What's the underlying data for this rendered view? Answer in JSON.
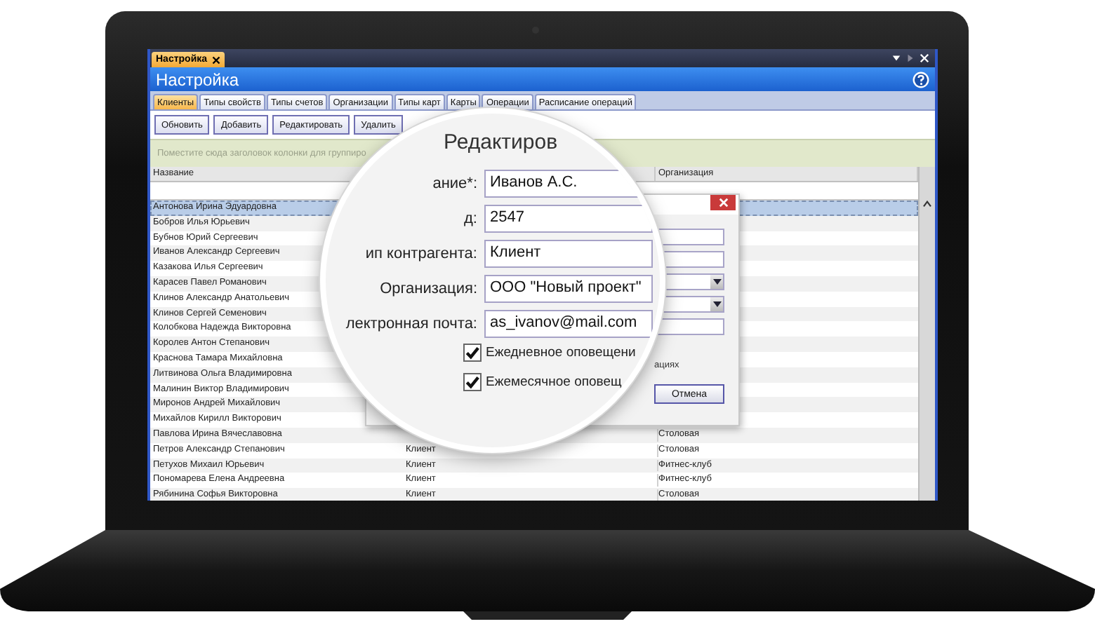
{
  "document_tab": {
    "title": "Настройка"
  },
  "window": {
    "title": "Настройка"
  },
  "tabs": [
    {
      "label": "Клиенты",
      "selected": true
    },
    {
      "label": "Типы свойств",
      "selected": false
    },
    {
      "label": "Типы счетов",
      "selected": false
    },
    {
      "label": "Организации",
      "selected": false
    },
    {
      "label": "Типы карт",
      "selected": false
    },
    {
      "label": "Карты",
      "selected": false
    },
    {
      "label": "Операции",
      "selected": false
    },
    {
      "label": "Расписание операций",
      "selected": false
    }
  ],
  "toolbar": {
    "buttons": [
      "Обновить",
      "Добавить",
      "Редактировать",
      "Удалить"
    ]
  },
  "group_panel": {
    "hint": "Поместите сюда заголовок колонки для группиро"
  },
  "table": {
    "columns": [
      "Название",
      "",
      "Организация"
    ],
    "rows": [
      {
        "name": "Антонова Ирина Эдуардовна",
        "selected": true
      },
      {
        "name": "Бобров Илья Юрьевич",
        "selected": false
      },
      {
        "name": "Бубнов Юрий Сергеевич",
        "selected": false
      },
      {
        "name": "Иванов Александр Сергеевич",
        "selected": false
      },
      {
        "name": "Казакова Илья Сергеевич",
        "selected": false
      },
      {
        "name": "Карасев Павел Романович",
        "selected": false
      },
      {
        "name": "Клинов Александр Анатольевич",
        "selected": false
      },
      {
        "name": "Клинов Сергей Семенович",
        "selected": false
      },
      {
        "name": "Колобкова Надежда Викторовна",
        "selected": false
      },
      {
        "name": "Королев Антон Степанович",
        "selected": false
      },
      {
        "name": "Краснова Тамара Михайловна",
        "selected": false
      },
      {
        "name": "Литвинова Ольга Владимировна",
        "selected": false
      },
      {
        "name": "Малинин Виктор Владимирович",
        "selected": false
      },
      {
        "name": "Миронов Андрей Михайлович",
        "selected": false
      },
      {
        "name": "Михайлов Кирилл Викторович",
        "selected": false
      },
      {
        "name": "Павлова Ирина Вячеславовна",
        "organization": "Столовая",
        "selected": false
      },
      {
        "name": "Петров Александр Степанович",
        "column_2": "Клиент",
        "organization": "Столовая",
        "selected": false
      },
      {
        "name": "Петухов Михаил Юрьевич",
        "column_2": "Клиент",
        "organization": "Фитнес-клуб",
        "selected": false
      },
      {
        "name": "Пономарева Елена Андреевна",
        "column_2": "Клиент",
        "organization": "Фитнес-клуб",
        "selected": false
      },
      {
        "name": "Рябинина Софья Викторовна",
        "column_2": "Клиент",
        "organization": "Столовая",
        "selected": false
      }
    ]
  },
  "dialog": {
    "fields": [
      {
        "kind": "text"
      },
      {
        "kind": "text"
      },
      {
        "kind": "dropdown"
      },
      {
        "kind": "dropdown"
      },
      {
        "kind": "text"
      }
    ],
    "hint_fragment": "ациях",
    "buttons": [
      "Отмена"
    ]
  },
  "magnifier": {
    "title": "Редактиров",
    "fields": [
      {
        "label": "ание*:",
        "value": "Иванов А.С."
      },
      {
        "label": "д:",
        "value": "2547"
      },
      {
        "label": "ип контрагента:",
        "value": "Клиент"
      },
      {
        "label": "Организация:",
        "value": "ООО \"Новый проект\""
      },
      {
        "label": "лектронная почта:",
        "value": "as_ivanov@mail.com"
      }
    ],
    "checkboxes": [
      {
        "label": "Ежедневное оповещени",
        "checked": true
      },
      {
        "label": "Ежемесячное оповещ",
        "checked": true
      }
    ]
  }
}
